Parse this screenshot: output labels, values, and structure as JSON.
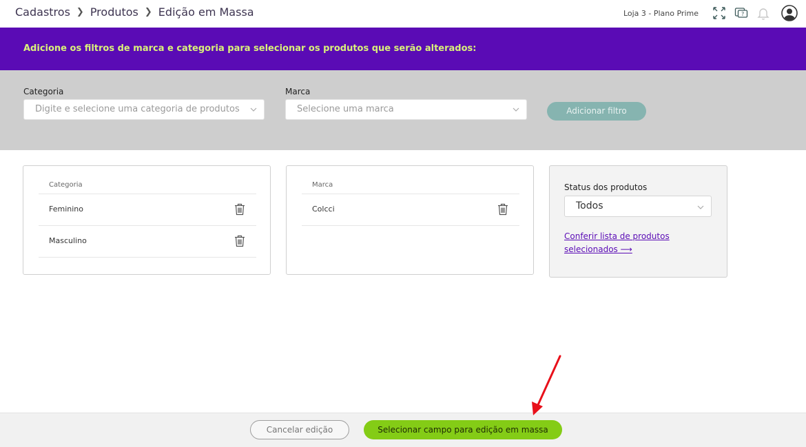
{
  "breadcrumb": {
    "items": [
      "Cadastros",
      "Produtos",
      "Edição em Massa"
    ]
  },
  "header": {
    "store_label": "Loja 3 - Plano Prime",
    "icons": [
      "expand-icon",
      "help-chat-icon",
      "bell-icon",
      "user-avatar-icon"
    ]
  },
  "banner": {
    "text": "Adicione os filtros de marca e categoria para selecionar os produtos que serão alterados:"
  },
  "filters": {
    "category_label": "Categoria",
    "category_placeholder": "Digite e selecione uma categoria de produtos",
    "brand_label": "Marca",
    "brand_placeholder": "Selecione uma marca",
    "add_button": "Adicionar filtro"
  },
  "category_card": {
    "header": "Categoria",
    "items": [
      "Feminino",
      "Masculino"
    ]
  },
  "brand_card": {
    "header": "Marca",
    "items": [
      "Colcci"
    ]
  },
  "status_card": {
    "title": "Status dos produtos",
    "selected": "Todos",
    "link": "Conferir lista de produtos selecionados ⟶"
  },
  "footer": {
    "cancel_label": "Cancelar edição",
    "main_label": "Selecionar campo para edição em massa"
  },
  "colors": {
    "banner": "#5a0bb5",
    "banner_text": "#d9f27a",
    "primary_button": "#84cc16",
    "add_filter_button": "#86b4b0",
    "annotation_arrow": "#e8101a"
  }
}
